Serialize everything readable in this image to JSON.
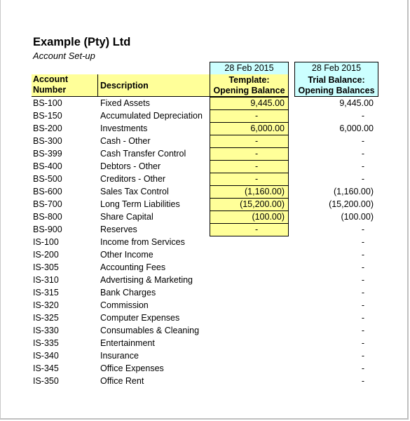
{
  "document": {
    "title": "Example (Pty) Ltd",
    "subtitle": "Account Set-up"
  },
  "columns": {
    "account_number": "Account Number",
    "account_number_line1": "Account",
    "account_number_line2": "Number",
    "description": "Description",
    "template": {
      "date": "28 Feb 2015",
      "line1": "Template:",
      "line2": "Opening Balance"
    },
    "trial_balance": {
      "date": "28 Feb 2015",
      "line1": "Trial Balance:",
      "line2": "Opening Balances"
    }
  },
  "colors": {
    "input_yellow": "#ffff99",
    "header_cyan": "#ccffff",
    "frame_gray": "#c0c0c0"
  },
  "rows": [
    {
      "code": "BS-100",
      "description": "Fixed Assets",
      "template": "9,445.00",
      "trial_balance": "9,445.00"
    },
    {
      "code": "BS-150",
      "description": "Accumulated Depreciation",
      "template": "-",
      "trial_balance": "-"
    },
    {
      "code": "BS-200",
      "description": "Investments",
      "template": "6,000.00",
      "trial_balance": "6,000.00"
    },
    {
      "code": "BS-300",
      "description": "Cash - Other",
      "template": "-",
      "trial_balance": "-"
    },
    {
      "code": "BS-399",
      "description": "Cash Transfer Control",
      "template": "-",
      "trial_balance": "-"
    },
    {
      "code": "BS-400",
      "description": "Debtors - Other",
      "template": "-",
      "trial_balance": "-"
    },
    {
      "code": "BS-500",
      "description": "Creditors - Other",
      "template": "-",
      "trial_balance": "-"
    },
    {
      "code": "BS-600",
      "description": "Sales Tax Control",
      "template": "(1,160.00)",
      "trial_balance": "(1,160.00)"
    },
    {
      "code": "BS-700",
      "description": "Long Term Liabilities",
      "template": "(15,200.00)",
      "trial_balance": "(15,200.00)"
    },
    {
      "code": "BS-800",
      "description": "Share Capital",
      "template": "(100.00)",
      "trial_balance": "(100.00)"
    },
    {
      "code": "BS-900",
      "description": "Reserves",
      "template": "-",
      "trial_balance": "-"
    },
    {
      "code": "IS-100",
      "description": "Income from Services",
      "template": null,
      "trial_balance": "-"
    },
    {
      "code": "IS-200",
      "description": "Other Income",
      "template": null,
      "trial_balance": "-"
    },
    {
      "code": "IS-305",
      "description": "Accounting Fees",
      "template": null,
      "trial_balance": "-"
    },
    {
      "code": "IS-310",
      "description": "Advertising & Marketing",
      "template": null,
      "trial_balance": "-"
    },
    {
      "code": "IS-315",
      "description": "Bank Charges",
      "template": null,
      "trial_balance": "-"
    },
    {
      "code": "IS-320",
      "description": "Commission",
      "template": null,
      "trial_balance": "-"
    },
    {
      "code": "IS-325",
      "description": "Computer Expenses",
      "template": null,
      "trial_balance": "-"
    },
    {
      "code": "IS-330",
      "description": "Consumables & Cleaning",
      "template": null,
      "trial_balance": "-"
    },
    {
      "code": "IS-335",
      "description": "Entertainment",
      "template": null,
      "trial_balance": "-"
    },
    {
      "code": "IS-340",
      "description": "Insurance",
      "template": null,
      "trial_balance": "-"
    },
    {
      "code": "IS-345",
      "description": "Office Expenses",
      "template": null,
      "trial_balance": "-"
    },
    {
      "code": "IS-350",
      "description": "Office Rent",
      "template": null,
      "trial_balance": "-"
    }
  ]
}
